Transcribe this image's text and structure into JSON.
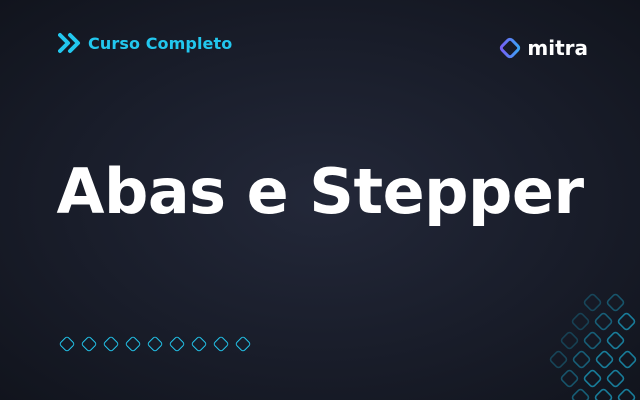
{
  "badge": {
    "icon": "double-chevron-right-icon",
    "label": "Curso Completo",
    "color": "#22c7ee"
  },
  "brand": {
    "icon": "mitra-diamond-logo-icon",
    "name": "mitra",
    "gradient": [
      "#7a5cf5",
      "#38a7f5"
    ]
  },
  "title": "Abas e Stepper",
  "decor": {
    "dot_count": 9,
    "accent": "#22c7ee",
    "pattern_color": "#1a8fb0"
  }
}
